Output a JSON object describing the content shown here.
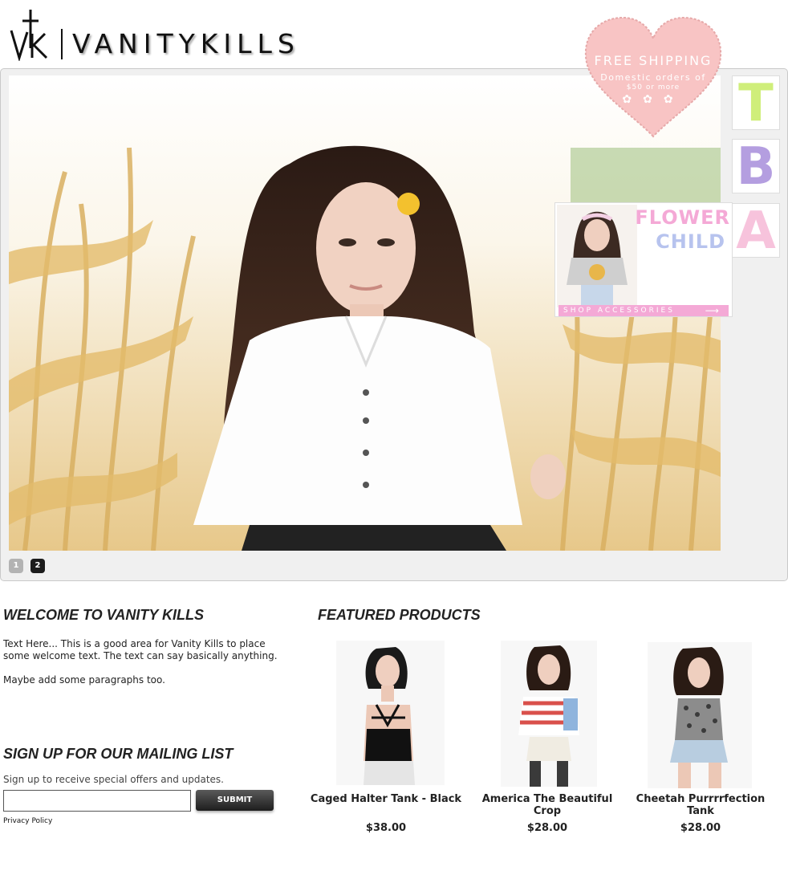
{
  "brand": {
    "name": "VANITYKILLS",
    "mark": "vk"
  },
  "promo": {
    "title": "FREE SHIPPING",
    "line1": "Domestic orders of",
    "line2": "$50 or more",
    "color": "#f8c4c4"
  },
  "slider": {
    "pages": [
      "1",
      "2"
    ],
    "active_page": "2"
  },
  "side_tiles": [
    "T",
    "B",
    "A"
  ],
  "ad": {
    "title_line1": "FLOWER",
    "title_line2": "CHILD",
    "cta": "SHOP ACCESSORIES"
  },
  "welcome": {
    "title": "WELCOME TO VANITY KILLS",
    "paragraph1": "Text Here... This is a good area for Vanity Kills to place some welcome text. The text can say basically anything.",
    "paragraph2": "Maybe add some paragraphs too."
  },
  "mailing": {
    "title": "SIGN UP FOR OUR MAILING LIST",
    "text": "Sign up to receive special offers and updates.",
    "email_value": "",
    "submit_label": "SUBMIT",
    "privacy_label": "Privacy Policy"
  },
  "featured": {
    "title": "FEATURED PRODUCTS",
    "products": [
      {
        "name": "Caged Halter Tank - Black",
        "price": "$38.00"
      },
      {
        "name": "America The Beautiful Crop",
        "price": "$28.00"
      },
      {
        "name": "Cheetah Purrrrfection Tank",
        "price": "$28.00"
      }
    ]
  }
}
